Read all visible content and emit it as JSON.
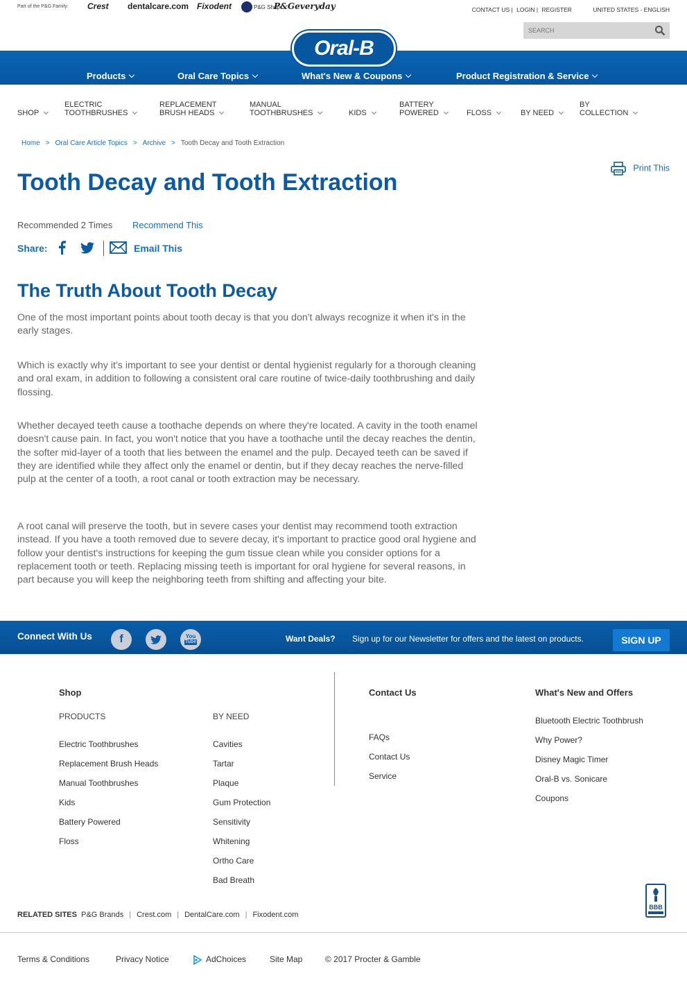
{
  "topbar": {
    "family_label": "Part of the P&G Family:",
    "brands": [
      "Crest",
      "dentalcare.com",
      "Fixodent",
      "P&G Shop",
      "P&Geveryday"
    ],
    "contact": "CONTACT US",
    "login": "LOGIN",
    "register": "REGISTER",
    "region": "UNITED STATES - ENGLISH",
    "search_placeholder": "SEARCH"
  },
  "logo": "Oral-B",
  "main_nav": [
    "Products",
    "Oral Care Topics",
    "What's New & Coupons",
    "Product Registration & Service"
  ],
  "categories": [
    {
      "l1": "",
      "l2": "SHOP"
    },
    {
      "l1": "ELECTRIC",
      "l2": "TOOTHBRUSHES"
    },
    {
      "l1": "REPLACEMENT",
      "l2": "BRUSH HEADS"
    },
    {
      "l1": "MANUAL",
      "l2": "TOOTHBRUSHES"
    },
    {
      "l1": "",
      "l2": "KIDS"
    },
    {
      "l1": "BATTERY",
      "l2": "POWERED"
    },
    {
      "l1": "",
      "l2": "FLOSS"
    },
    {
      "l1": "",
      "l2": "BY NEED"
    },
    {
      "l1": "BY",
      "l2": "COLLECTION"
    }
  ],
  "breadcrumb": [
    "Home",
    "Oral Care Article Topics",
    "Archive",
    "Tooth Decay and Tooth Extraction"
  ],
  "print_label": "Print This",
  "article": {
    "title": "Tooth Decay and Tooth Extraction",
    "recommended": "Recommended 2 Times",
    "recommend_link": "Recommend This",
    "share_label": "Share:",
    "email_label": "Email This",
    "subtitle": "The Truth About Tooth Decay",
    "paragraphs": [
      "One of the most important points about tooth decay is that you don't always recognize it when it's in the early stages.",
      "Which is exactly why it’s important to see your dentist or dental hygienist regularly for a thorough cleaning and oral exam, in addition to following a consistent oral care routine of twice-daily toothbrushing and daily flossing.",
      "Whether decayed teeth cause a toothache depends on where they're located. A cavity in the tooth enamel doesn't cause pain. In fact, you won't notice that you have a toothache until the decay reaches the dentin, the softer mid-layer of a tooth that lies between the enamel and the pulp. Decayed teeth can be saved if they are identified while they affect only the enamel or dentin, but if they decay reaches the nerve-filled pulp at the center of a tooth, a root canal or tooth extraction may be necessary.",
      "A root canal will preserve the tooth, but in severe cases your dentist may recommend tooth extraction instead. If you have a tooth removed due to severe decay, it's important to practice good oral hygiene and follow your dentist's instructions for keeping the gum tissue clean while you consider options for a replacement tooth or teeth. Replacing missing teeth is important for oral hygiene for several reasons, in part because you will keep the neighboring teeth from shifting and affecting your bite."
    ]
  },
  "connect": {
    "label": "Connect With Us",
    "deals_label": "Want Deals?",
    "deals_text": "Sign up for our Newsletter for offers and the latest on products.",
    "signup": "SIGN UP"
  },
  "footer": {
    "shop_heading": "Shop",
    "products_heading": "PRODUCTS",
    "products": [
      "Electric Toothbrushes",
      "Replacement Brush Heads",
      "Manual Toothbrushes",
      "Kids",
      "Battery Powered",
      "Floss"
    ],
    "byneed_heading": "BY NEED",
    "byneed": [
      "Cavities",
      "Tartar",
      "Plaque",
      "Gum Protection",
      "Sensitivity",
      "Whitening",
      "Ortho Care",
      "Bad Breath"
    ],
    "contact_heading": "Contact Us",
    "contact": [
      "FAQs",
      "Contact Us",
      "Service"
    ],
    "whatsnew_heading": "What's New and Offers",
    "whatsnew": [
      "Bluetooth Electric Toothbrush",
      "Why Power?",
      "Disney Magic Timer",
      "Oral-B vs. Sonicare",
      "Coupons"
    ],
    "related_label": "RELATED SITES",
    "related": [
      "P&G Brands",
      "Crest.com",
      "DentalCare.com",
      "Fixodent.com"
    ],
    "legal": [
      "Terms & Conditions",
      "Privacy Notice",
      "AdChoices",
      "Site Map",
      "© 2017 Procter & Gamble"
    ]
  },
  "colors": {
    "brand_blue": "#0656a0",
    "link_blue": "#1a6eb8",
    "title_blue": "#0b5aa2",
    "button_blue": "#1479d0"
  }
}
